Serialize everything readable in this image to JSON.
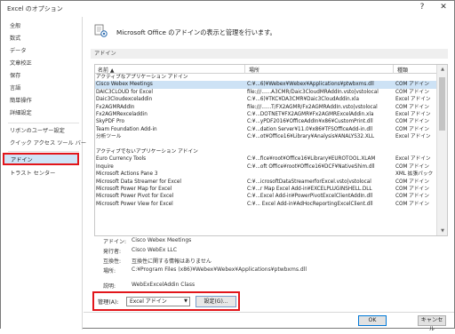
{
  "window": {
    "title": "Excel のオプション",
    "help": "?",
    "close": "✕"
  },
  "sidebar": {
    "items": [
      {
        "label": "全般"
      },
      {
        "label": "数式"
      },
      {
        "label": "データ"
      },
      {
        "label": "文章校正"
      },
      {
        "label": "保存"
      },
      {
        "label": "言語"
      },
      {
        "label": "簡単操作"
      },
      {
        "label": "詳細設定"
      },
      {
        "label": "リボンのユーザー設定"
      },
      {
        "label": "クイック アクセス ツール バー"
      },
      {
        "label": "アドイン"
      },
      {
        "label": "トラスト センター"
      }
    ],
    "active": "アドイン"
  },
  "header": {
    "text": "Microsoft Office のアドインの表示と管理を行います。"
  },
  "section": {
    "title": "アドイン"
  },
  "table": {
    "headers": [
      "名前 ▲",
      "場所",
      "種類"
    ],
    "rows": [
      {
        "type": "group",
        "c1": "アクティブなアプリケーション アドイン",
        "c2": "",
        "c3": ""
      },
      {
        "type": "sel",
        "c1": "Cisco Webex Meetings",
        "c2": "C:¥...6)¥Webex¥Webex¥Applications¥ptwbxms.dll",
        "c3": "COM アドイン"
      },
      {
        "type": "row",
        "c1": "DAIC3CLOUD for Excel",
        "c2": "file:///......A3CMR/Daic3CloudMRAddIn.vsto|vstolocal",
        "c3": "COM アドイン"
      },
      {
        "type": "row",
        "c1": "Daic3Cloudexceladdin",
        "c2": "C:¥...6)¥TKC¥DA3CMR¥Daic3CloudAddin.xla",
        "c3": "Excel アドイン"
      },
      {
        "type": "row",
        "c1": "Fx2AGMRAddIn",
        "c2": "file:///......T/FX2AGMR/Fx2AGMRAddIn.vsto|vstolocal",
        "c3": "COM アドイン"
      },
      {
        "type": "row",
        "c1": "Fx2AGMRexceladdin",
        "c2": "C:¥...DOTNET¥FX2AGMR¥Fx2AGMRExcelAddin.xla",
        "c3": "Excel アドイン"
      },
      {
        "type": "row",
        "c1": "SkyPDF Pro",
        "c2": "C:¥...yPDF2016¥OfficeAddIn¥x86¥CustomPrint.dll",
        "c3": "COM アドイン"
      },
      {
        "type": "row",
        "c1": "Team Foundation Add-in",
        "c2": "C:¥...dation Server¥11.0¥x86¥TFSOfficeAdd-in.dll",
        "c3": "COM アドイン"
      },
      {
        "type": "row",
        "c1": "分析ツール",
        "c2": "C:¥...ot¥Office16¥Library¥Analysis¥ANALYS32.XLL",
        "c3": "Excel アドイン"
      },
      {
        "type": "blank",
        "c1": "",
        "c2": "",
        "c3": ""
      },
      {
        "type": "group",
        "c1": "アクティブでないアプリケーション アドイン",
        "c2": "",
        "c3": ""
      },
      {
        "type": "row",
        "c1": "Euro Currency Tools",
        "c2": "C:¥...fice¥root¥Office16¥Library¥EUROTOOL.XLAM",
        "c3": "Excel アドイン"
      },
      {
        "type": "row",
        "c1": "Inquire",
        "c2": "C:¥...oft Office¥root¥Office16¥DCF¥NativeShim.dll",
        "c3": "COM アドイン"
      },
      {
        "type": "row",
        "c1": "Microsoft Actions Pane 3",
        "c2": "",
        "c3": "XML 拡張パック"
      },
      {
        "type": "row",
        "c1": "Microsoft Data Streamer for Excel",
        "c2": "C:¥...icrosoftDataStreamerforExcel.vsto|vstolocal",
        "c3": "COM アドイン"
      },
      {
        "type": "row",
        "c1": "Microsoft Power Map for Excel",
        "c2": "C:¥...r Map Excel Add-in¥EXCELPLUGINSHELL.DLL",
        "c3": "COM アドイン"
      },
      {
        "type": "row",
        "c1": "Microsoft Power Pivot for Excel",
        "c2": "C:¥...Excel Add-in¥PowerPivotExcelClientAddIn.dll",
        "c3": "COM アドイン"
      },
      {
        "type": "row",
        "c1": "Microsoft Power View for Excel",
        "c2": "C:¥... Excel Add-in¥AdHocReportingExcelClient.dll",
        "c3": "COM アドイン"
      }
    ]
  },
  "details": {
    "addin": {
      "label": "アドイン:",
      "value": "Cisco Webex Meetings"
    },
    "publisher": {
      "label": "発行者:",
      "value": "Cisco WebEx LLC"
    },
    "compat": {
      "label": "互換性:",
      "value": "互換性に関する情報はありません"
    },
    "location": {
      "label": "場所:",
      "value": "C:¥Program Files (x86)¥Webex¥Webex¥Applications¥ptwbxms.dll"
    },
    "description": {
      "label": "説明:",
      "value": "WebExExcelAddin Class"
    }
  },
  "manage": {
    "label": "管理(A):",
    "selected": "Excel アドイン",
    "go": "設定(G)..."
  },
  "footer": {
    "ok": "OK",
    "cancel": "キャンセル"
  }
}
